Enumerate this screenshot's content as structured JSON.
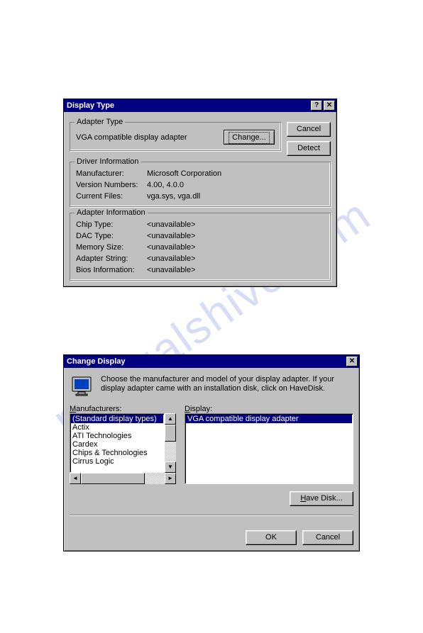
{
  "watermark": "manualshive.com",
  "dlg1": {
    "title": "Display Type",
    "help_glyph": "?",
    "close_glyph": "✕",
    "adapter_group": "Adapter Type",
    "adapter_text": "VGA compatible display adapter",
    "change_btn": "Change...",
    "cancel_btn": "Cancel",
    "detect_btn": "Detect",
    "driver_group": "Driver Information",
    "mfr_label": "Manufacturer:",
    "mfr_value": "Microsoft Corporation",
    "ver_label": "Version Numbers:",
    "ver_value": "4.00, 4.0.0",
    "files_label": "Current Files:",
    "files_value": "vga.sys, vga.dll",
    "adapterinfo_group": "Adapter Information",
    "chip_label": "Chip Type:",
    "chip_value": "<unavailable>",
    "dac_label": "DAC Type:",
    "dac_value": "<unavailable>",
    "mem_label": "Memory Size:",
    "mem_value": "<unavailable>",
    "str_label": "Adapter String:",
    "str_value": "<unavailable>",
    "bios_label": "Bios Information:",
    "bios_value": "<unavailable>"
  },
  "dlg2": {
    "title": "Change Display",
    "close_glyph": "✕",
    "intro": "Choose the manufacturer and model of your display adapter.  If your display adapter came with an installation disk, click on HaveDisk.",
    "mfr_label": "Manufacturers:",
    "disp_label": "Display:",
    "mfr_list": [
      "(Standard display types)",
      "Actix",
      "ATI Technologies",
      "Cardex",
      "Chips & Technologies",
      "Cirrus Logic"
    ],
    "disp_list": [
      "VGA compatible display adapter"
    ],
    "have_disk_btn": "Have Disk...",
    "ok_btn": "OK",
    "cancel_btn": "Cancel"
  }
}
